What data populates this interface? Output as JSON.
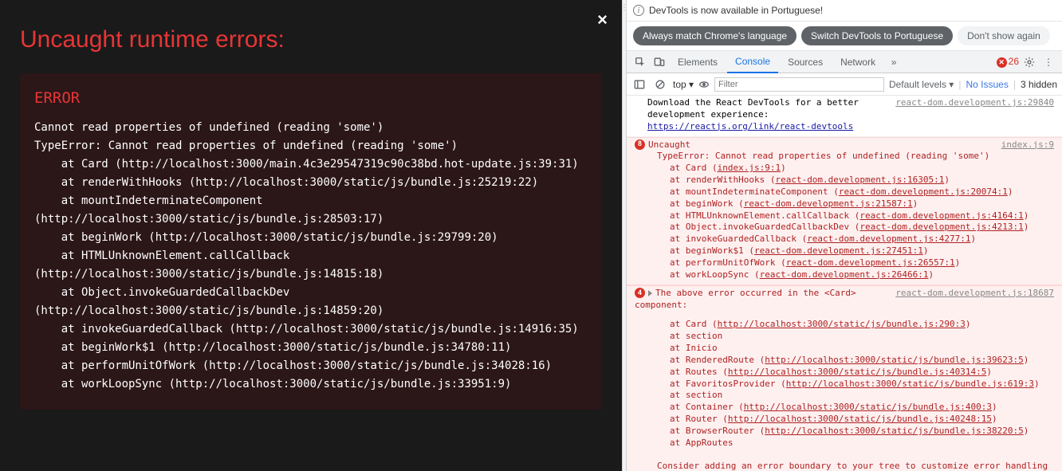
{
  "overlay": {
    "title": "Uncaught runtime errors:",
    "close": "×",
    "label": "ERROR",
    "trace": "Cannot read properties of undefined (reading 'some')\nTypeError: Cannot read properties of undefined (reading 'some')\n    at Card (http://localhost:3000/main.4c3e29547319c90c38bd.hot-update.js:39:31)\n    at renderWithHooks (http://localhost:3000/static/js/bundle.js:25219:22)\n    at mountIndeterminateComponent (http://localhost:3000/static/js/bundle.js:28503:17)\n    at beginWork (http://localhost:3000/static/js/bundle.js:29799:20)\n    at HTMLUnknownElement.callCallback (http://localhost:3000/static/js/bundle.js:14815:18)\n    at Object.invokeGuardedCallbackDev (http://localhost:3000/static/js/bundle.js:14859:20)\n    at invokeGuardedCallback (http://localhost:3000/static/js/bundle.js:14916:35)\n    at beginWork$1 (http://localhost:3000/static/js/bundle.js:34780:11)\n    at performUnitOfWork (http://localhost:3000/static/js/bundle.js:34028:16)\n    at workLoopSync (http://localhost:3000/static/js/bundle.js:33951:9)"
  },
  "devtools": {
    "info_text": "DevTools is now available in Portuguese!",
    "chips": {
      "match": "Always match Chrome's language",
      "switch": "Switch DevTools to Portuguese",
      "dont": "Don't show again"
    },
    "tabs": {
      "elements": "Elements",
      "console": "Console",
      "sources": "Sources",
      "network": "Network"
    },
    "error_count": "26",
    "filter": {
      "top": "top ▾",
      "placeholder": "Filter",
      "levels": "Default levels ▾",
      "no_issues": "No Issues",
      "hidden": "3 hidden"
    },
    "console": {
      "loc0": "react-dom.development.js:29840",
      "line0a": "Download the React DevTools for a better development experience:",
      "line0b": "https://reactjs.org/link/react-devtools",
      "err1_badge": "8",
      "err1_title": "Uncaught",
      "err1_loc": "index.js:9",
      "err1_body": "TypeError: Cannot read properties of undefined (reading 'some')",
      "err1_trace": [
        {
          "pre": "at Card (",
          "link": "index.js:9:1",
          "post": ")"
        },
        {
          "pre": "at renderWithHooks (",
          "link": "react-dom.development.js:16305:1",
          "post": ")"
        },
        {
          "pre": "at mountIndeterminateComponent (",
          "link": "react-dom.development.js:20074:1",
          "post": ")"
        },
        {
          "pre": "at beginWork (",
          "link": "react-dom.development.js:21587:1",
          "post": ")"
        },
        {
          "pre": "at HTMLUnknownElement.callCallback (",
          "link": "react-dom.development.js:4164:1",
          "post": ")"
        },
        {
          "pre": "at Object.invokeGuardedCallbackDev (",
          "link": "react-dom.development.js:4213:1",
          "post": ")"
        },
        {
          "pre": "at invokeGuardedCallback (",
          "link": "react-dom.development.js:4277:1",
          "post": ")"
        },
        {
          "pre": "at beginWork$1 (",
          "link": "react-dom.development.js:27451:1",
          "post": ")"
        },
        {
          "pre": "at performUnitOfWork (",
          "link": "react-dom.development.js:26557:1",
          "post": ")"
        },
        {
          "pre": "at workLoopSync (",
          "link": "react-dom.development.js:26466:1",
          "post": ")"
        }
      ],
      "err2_badge": "4",
      "err2_loc": "react-dom.development.js:18687",
      "err2_title": "The above error occurred in the <Card> component:",
      "err2_trace": [
        {
          "pre": "at Card (",
          "link": "http://localhost:3000/static/js/bundle.js:290:3",
          "post": ")"
        },
        {
          "pre": "at section",
          "link": "",
          "post": ""
        },
        {
          "pre": "at Inicio",
          "link": "",
          "post": ""
        },
        {
          "pre": "at RenderedRoute (",
          "link": "http://localhost:3000/static/js/bundle.js:39623:5",
          "post": ")"
        },
        {
          "pre": "at Routes (",
          "link": "http://localhost:3000/static/js/bundle.js:40314:5",
          "post": ")"
        },
        {
          "pre": "at FavoritosProvider (",
          "link": "http://localhost:3000/static/js/bundle.js:619:3",
          "post": ")"
        },
        {
          "pre": "at section",
          "link": "",
          "post": ""
        },
        {
          "pre": "at Container (",
          "link": "http://localhost:3000/static/js/bundle.js:400:3",
          "post": ")"
        },
        {
          "pre": "at Router (",
          "link": "http://localhost:3000/static/js/bundle.js:40248:15",
          "post": ")"
        },
        {
          "pre": "at BrowserRouter (",
          "link": "http://localhost:3000/static/js/bundle.js:38220:5",
          "post": ")"
        },
        {
          "pre": "at AppRoutes",
          "link": "",
          "post": ""
        }
      ],
      "err2_footer": "Consider adding an error boundary to your tree to customize error handling"
    }
  }
}
